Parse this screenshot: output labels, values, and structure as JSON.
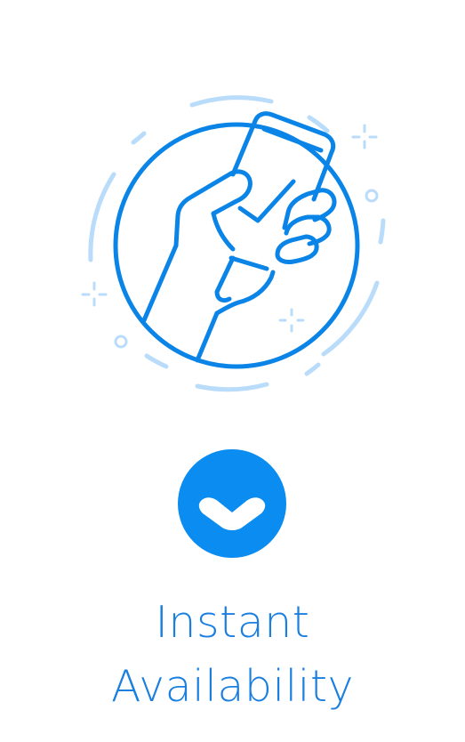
{
  "title": {
    "line1": "Instant",
    "line2": "Availability"
  },
  "illustration": {
    "icon": "hand-holding-phone-check-icon"
  },
  "toggle": {
    "icon": "chevron-down-icon"
  },
  "colors": {
    "primary": "#0a84e6",
    "light": "#b9dcfa",
    "button": "#0a8cf0",
    "title": "#1b7fe0"
  }
}
